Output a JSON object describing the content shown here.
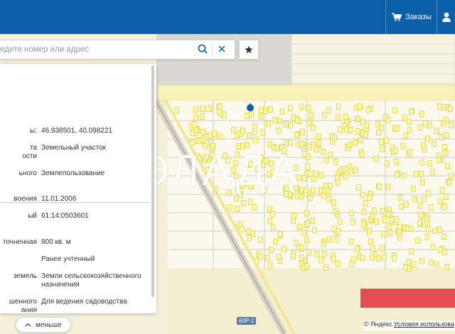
{
  "header": {
    "orders_label": "Заказы"
  },
  "search": {
    "placeholder": "едите номер или адрес"
  },
  "colors": {
    "brand": "#0a5fa8",
    "plot_fill": "#fbf7a8",
    "plot_stroke": "#d6c82a",
    "marker": "#0a5fa8",
    "accent_red": "#e0303a"
  },
  "info": {
    "rows": [
      {
        "label": "ы:",
        "value": "46.938501, 40.098221"
      },
      {
        "label": "та\nости",
        "value": "Земельный участок"
      },
      {
        "label": "ьного",
        "value": "Землепользование"
      },
      {
        "label": "воения",
        "value": "11.01.2006"
      },
      {
        "label": "ый",
        "value": "61:14:0503601"
      },
      {
        "label": "точненная",
        "value": "800 кв. м"
      },
      {
        "label": "",
        "value": "Ранее учтенный"
      },
      {
        "label": "земель",
        "value": "Земли сельскохозяйственного назначения"
      },
      {
        "label": "шенного\nания",
        "value": "Для ведения садоводства"
      }
    ]
  },
  "toggle": {
    "less_label": "меньше"
  },
  "map": {
    "watermark": "ЭЛАДА",
    "road_label": "60Р-1",
    "attribution_prefix": "© Яндекс",
    "attribution_link": "Условия использова"
  }
}
